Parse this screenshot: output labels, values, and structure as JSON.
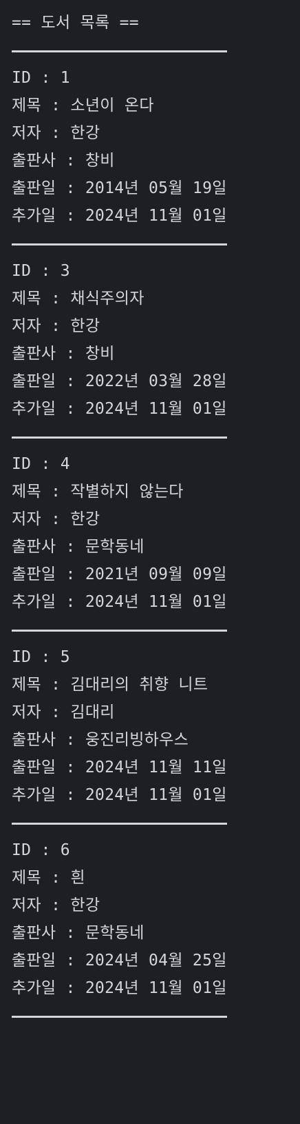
{
  "header": "== 도서 목록 ==",
  "labels": {
    "id": "ID : ",
    "title": "제목 : ",
    "author": "저자 : ",
    "publisher": "출판사 : ",
    "published": "출판일 : ",
    "added": "추가일 : "
  },
  "books": [
    {
      "id": "1",
      "title": "소년이 온다",
      "author": "한강",
      "publisher": "창비",
      "published": "2014년 05월 19일",
      "added": "2024년 11월 01일"
    },
    {
      "id": "3",
      "title": "채식주의자",
      "author": "한강",
      "publisher": "창비",
      "published": "2022년 03월 28일",
      "added": "2024년 11월 01일"
    },
    {
      "id": "4",
      "title": "작별하지 않는다",
      "author": "한강",
      "publisher": "문학동네",
      "published": "2021년 09월 09일",
      "added": "2024년 11월 01일"
    },
    {
      "id": "5",
      "title": "김대리의 취향 니트",
      "author": "김대리",
      "publisher": "웅진리빙하우스",
      "published": "2024년 11월 11일",
      "added": "2024년 11월 01일"
    },
    {
      "id": "6",
      "title": "흰",
      "author": "한강",
      "publisher": "문학동네",
      "published": "2024년 04월 25일",
      "added": "2024년 11월 01일"
    }
  ]
}
